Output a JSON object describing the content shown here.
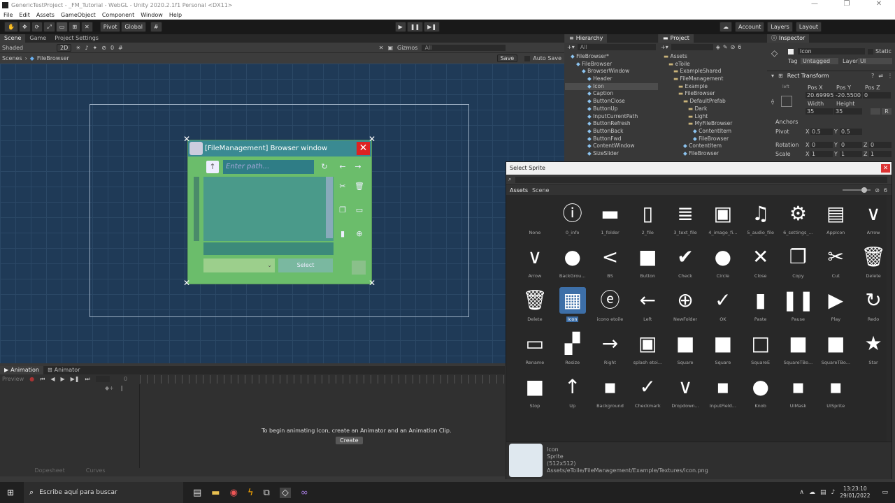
{
  "window": {
    "title": "GenericTestProject - _FM_Tutorial - WebGL - Unity 2020.2.1f1 Personal <DX11>",
    "controls": [
      "—",
      "❐",
      "✕"
    ]
  },
  "menu": [
    "File",
    "Edit",
    "Assets",
    "GameObject",
    "Component",
    "Window",
    "Help"
  ],
  "toolbar": {
    "pivot": "Pivot",
    "global": "Global",
    "account": "Account",
    "layers": "Layers",
    "layout": "Layout"
  },
  "scene": {
    "tabs": [
      "Scene",
      "Game",
      "Project Settings"
    ],
    "shading": "Shaded",
    "mode2d": "2D",
    "gizmos": "Gizmos",
    "search_placeholder": "All",
    "save": "Save",
    "autosave": "Auto Save",
    "breadcrumb_root": "Scenes",
    "breadcrumb_item": "FileBrowser",
    "visible_count": "0"
  },
  "filebrowser": {
    "title": "[FileManagement] Browser window",
    "path_placeholder": "Enter path...",
    "select": "Select"
  },
  "hierarchy": {
    "tab": "Hierarchy",
    "search_placeholder": "All",
    "items": [
      {
        "label": "FileBrowser*"
      },
      {
        "label": "FileBrowser"
      },
      {
        "label": "BrowserWindow"
      },
      {
        "label": "Header"
      },
      {
        "label": "Icon",
        "selected": true
      },
      {
        "label": "Caption"
      },
      {
        "label": "ButtonClose"
      },
      {
        "label": "ButtonUp"
      },
      {
        "label": "InputCurrentPath"
      },
      {
        "label": "ButtonRefresh"
      },
      {
        "label": "ButtonBack"
      },
      {
        "label": "ButtonFwd"
      },
      {
        "label": "ContentWindow"
      },
      {
        "label": "SizeSlider"
      }
    ]
  },
  "project": {
    "tab": "Project",
    "hidden_count": "6",
    "items": [
      {
        "label": "Assets"
      },
      {
        "label": "eToile"
      },
      {
        "label": "ExampleShared"
      },
      {
        "label": "FileManagement"
      },
      {
        "label": "Example"
      },
      {
        "label": "FileBrowser"
      },
      {
        "label": "DefaultPrefab"
      },
      {
        "label": "Dark"
      },
      {
        "label": "Light"
      },
      {
        "label": "MyFileBrowser"
      },
      {
        "label": "ContentItem"
      },
      {
        "label": "FileBrowser"
      },
      {
        "label": "ContentItem"
      },
      {
        "label": "FileBrowser"
      }
    ]
  },
  "inspector": {
    "tab": "Inspector",
    "name": "Icon",
    "static": "Static",
    "tag_label": "Tag",
    "tag": "Untagged",
    "layer_label": "Layer",
    "layer": "UI",
    "component": "Rect Transform",
    "left": "left",
    "posx_label": "Pos X",
    "posy_label": "Pos Y",
    "posz_label": "Pos Z",
    "posx": "20.69995",
    "posy": "-20.5500",
    "posz": "0",
    "width_label": "Width",
    "height_label": "Height",
    "width": "35",
    "height": "35",
    "r_button": "R",
    "anchors": "Anchors",
    "pivot_label": "Pivot",
    "pivot_x_label": "X",
    "pivot_y_label": "Y",
    "pivot_x": "0.5",
    "pivot_y": "0.5",
    "rotation_label": "Rotation",
    "rot_x": "0",
    "rot_y": "0",
    "rot_z": "0",
    "scale_label": "Scale",
    "scale_x": "1",
    "scale_y": "1",
    "scale_z": "1",
    "axis_x": "X",
    "axis_y": "Y",
    "axis_z": "Z"
  },
  "animation": {
    "tabs": [
      "Animation",
      "Animator"
    ],
    "preview": "Preview",
    "timeline_start": "0",
    "message": "To begin animating Icon, create an Animator and an Animation Clip.",
    "create": "Create",
    "bottom_tabs": [
      "Dopesheet",
      "Curves"
    ]
  },
  "selectsprite": {
    "title": "Select Sprite",
    "tabs": [
      "Assets",
      "Scene"
    ],
    "hidden_count": "6",
    "info": {
      "name": "Icon",
      "type": "Sprite",
      "size": "(512x512)",
      "path": "Assets/eToile/FileManagement/Example/Textures/icon.png"
    },
    "sprites": [
      {
        "label": "None",
        "glyph": ""
      },
      {
        "label": "0_info",
        "glyph": "ⓘ"
      },
      {
        "label": "1_folder",
        "glyph": "▬"
      },
      {
        "label": "2_file",
        "glyph": "▯"
      },
      {
        "label": "3_text_file",
        "glyph": "≣"
      },
      {
        "label": "4_image_fi...",
        "glyph": "▣"
      },
      {
        "label": "5_audio_file",
        "glyph": "♫"
      },
      {
        "label": "6_settings_...",
        "glyph": "⚙"
      },
      {
        "label": "AppIcon",
        "glyph": "▤"
      },
      {
        "label": "Arrow",
        "glyph": "∨"
      },
      {
        "label": "Arrow",
        "glyph": "∨"
      },
      {
        "label": "BackGrou...",
        "glyph": "●"
      },
      {
        "label": "BS",
        "glyph": "<"
      },
      {
        "label": "Button",
        "glyph": "■"
      },
      {
        "label": "Check",
        "glyph": "✔"
      },
      {
        "label": "Circle",
        "glyph": "●"
      },
      {
        "label": "Close",
        "glyph": "✕"
      },
      {
        "label": "Copy",
        "glyph": "❐"
      },
      {
        "label": "Cut",
        "glyph": "✂"
      },
      {
        "label": "Delete",
        "glyph": "🗑"
      },
      {
        "label": "Delete",
        "glyph": "🗑"
      },
      {
        "label": "Icon",
        "glyph": "▦",
        "selected": true
      },
      {
        "label": "icono etoile",
        "glyph": "ⓔ"
      },
      {
        "label": "Left",
        "glyph": "←"
      },
      {
        "label": "NewFolder",
        "glyph": "⊕"
      },
      {
        "label": "OK",
        "glyph": "✓"
      },
      {
        "label": "Paste",
        "glyph": "▮"
      },
      {
        "label": "Pause",
        "glyph": "❚❚"
      },
      {
        "label": "Play",
        "glyph": "▶"
      },
      {
        "label": "Redo",
        "glyph": "↻"
      },
      {
        "label": "Rename",
        "glyph": "▭"
      },
      {
        "label": "Resize",
        "glyph": "▞"
      },
      {
        "label": "Right",
        "glyph": "→"
      },
      {
        "label": "splash etoi...",
        "glyph": "▣"
      },
      {
        "label": "Square",
        "glyph": "■"
      },
      {
        "label": "Square",
        "glyph": "■"
      },
      {
        "label": "SquareE",
        "glyph": "□"
      },
      {
        "label": "SquareTBo...",
        "glyph": "■"
      },
      {
        "label": "SquareTBo...",
        "glyph": "■"
      },
      {
        "label": "Star",
        "glyph": "★"
      },
      {
        "label": "Stop",
        "glyph": "■"
      },
      {
        "label": "Up",
        "glyph": "↑"
      },
      {
        "label": "Background",
        "glyph": "▪"
      },
      {
        "label": "Checkmark",
        "glyph": "✓"
      },
      {
        "label": "Dropdown...",
        "glyph": "∨"
      },
      {
        "label": "InputField...",
        "glyph": "▪"
      },
      {
        "label": "Knob",
        "glyph": "●"
      },
      {
        "label": "UIMask",
        "glyph": "▪"
      },
      {
        "label": "UISprite",
        "glyph": "▪"
      }
    ]
  },
  "taskbar": {
    "search_placeholder": "Escribe aquí para buscar",
    "time": "13:23:10",
    "date": "29/01/2022"
  }
}
